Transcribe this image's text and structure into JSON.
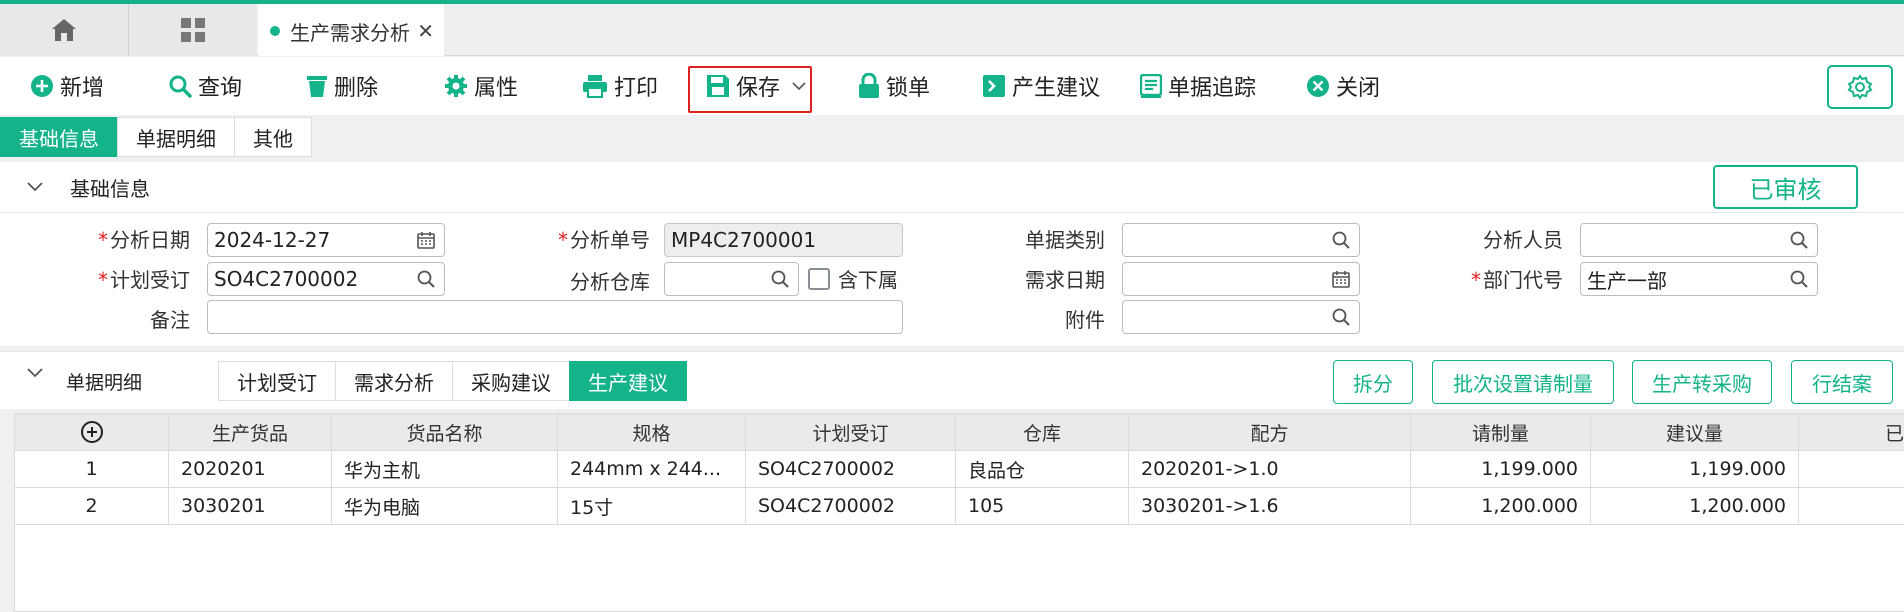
{
  "tabs": {
    "active_label": "生产需求分析",
    "close_glyph": "✕"
  },
  "toolbar": {
    "add": "新增",
    "query": "查询",
    "delete": "删除",
    "props": "属性",
    "print": "打印",
    "save": "保存",
    "lock": "锁单",
    "suggest": "产生建议",
    "track": "单据追踪",
    "close": "关闭"
  },
  "subtabs": [
    "基础信息",
    "单据明细",
    "其他"
  ],
  "basic": {
    "section_title": "基础信息",
    "status": "已审核",
    "labels": {
      "date": "分析日期",
      "number": "分析单号",
      "doc_type": "单据类别",
      "analyst": "分析人员",
      "plan_order": "计划受订",
      "warehouse": "分析仓库",
      "include_sub": "含下属",
      "demand_date": "需求日期",
      "dept": "部门代号",
      "remark": "备注",
      "attachment": "附件"
    },
    "values": {
      "date": "2024-12-27",
      "number": "MP4C2700001",
      "doc_type": "",
      "analyst": "",
      "plan_order": "SO4C2700002",
      "warehouse": "",
      "demand_date": "",
      "dept": "生产一部",
      "remark": "",
      "attachment": ""
    },
    "required_mark": "*"
  },
  "detail": {
    "section_title": "单据明细",
    "tabs": [
      "计划受订",
      "需求分析",
      "采购建议",
      "生产建议"
    ],
    "buttons": [
      "拆分",
      "批次设置请制量",
      "生产转采购",
      "行结案"
    ],
    "columns": [
      "生产货品",
      "货品名称",
      "规格",
      "计划受订",
      "仓库",
      "配方",
      "请制量",
      "建议量",
      "已"
    ],
    "rows": [
      [
        "1",
        "2020201",
        "华为主机",
        "244mm x 244...",
        "SO4C2700002",
        "良品仓",
        "2020201->1.0",
        "1,199.000",
        "1,199.000"
      ],
      [
        "2",
        "3030201",
        "华为电脑",
        "15寸",
        "SO4C2700002",
        "105",
        "3030201->1.6",
        "1,200.000",
        "1,200.000"
      ]
    ]
  },
  "colors": {
    "accent": "#14b38a",
    "required": "#e02020"
  }
}
